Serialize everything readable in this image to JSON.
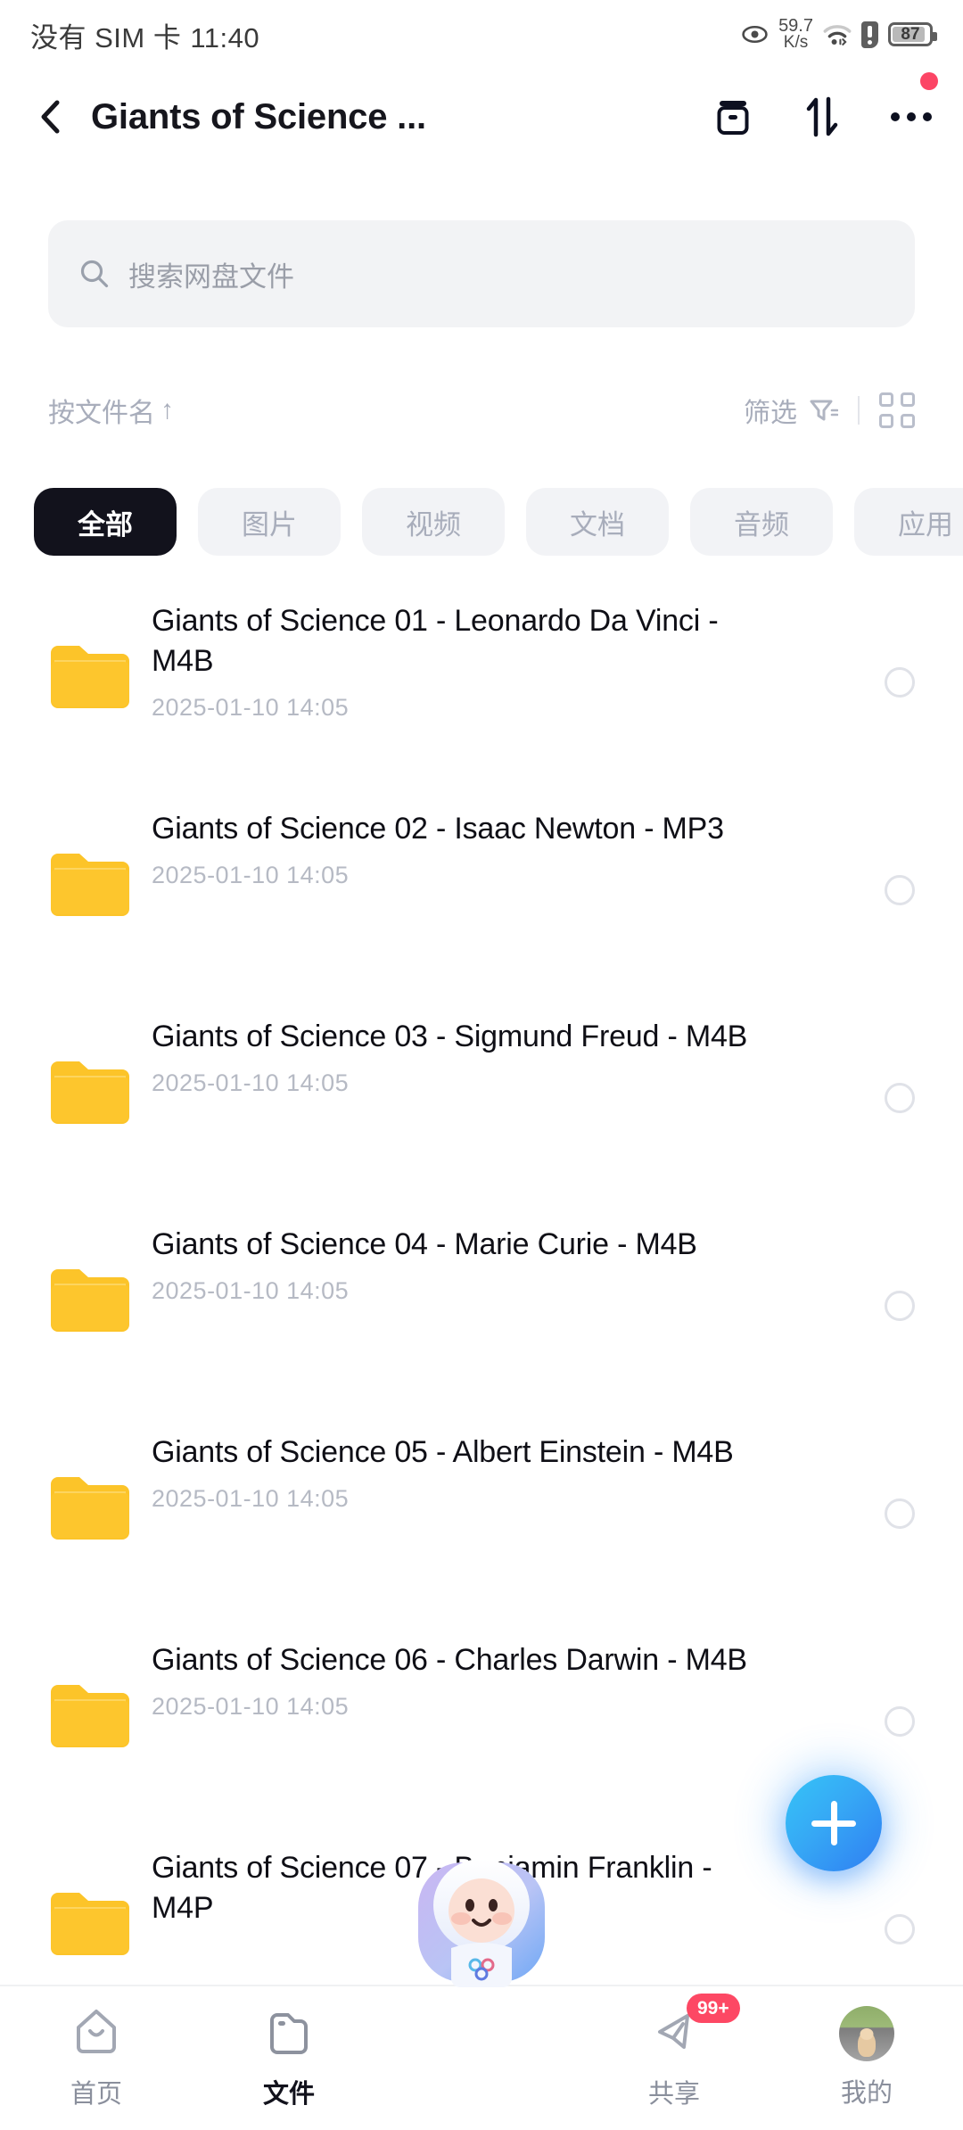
{
  "statusbar": {
    "carrier": "没有 SIM 卡",
    "time": "11:40",
    "net_speed": "59.7",
    "net_unit": "K/s",
    "battery": "87",
    "icons": [
      "eye-icon",
      "wifi-icon",
      "sim-warning-icon",
      "battery-icon"
    ]
  },
  "header": {
    "title": "Giants of Science ...",
    "back_icon": "chevron-left-icon",
    "archive_icon": "archive-box-icon",
    "transfer_icon": "transfer-up-down-icon",
    "more_icon": "more-dots-icon",
    "more_badge": true
  },
  "search": {
    "placeholder": "搜索网盘文件",
    "icon": "search-icon"
  },
  "sort_row": {
    "sort_label": "按文件名",
    "sort_arrow": "↑",
    "filter_label": "筛选",
    "filter_icon": "funnel-icon",
    "view_icon": "grid-view-icon"
  },
  "chips": [
    {
      "label": "全部",
      "active": true
    },
    {
      "label": "图片",
      "active": false
    },
    {
      "label": "视频",
      "active": false
    },
    {
      "label": "文档",
      "active": false
    },
    {
      "label": "音频",
      "active": false
    },
    {
      "label": "应用",
      "active": false
    },
    {
      "label": "",
      "active": false
    }
  ],
  "files": [
    {
      "name": "Giants of Science 01 - Leonardo Da Vinci - M4B",
      "date": "2025-01-10",
      "time": "14:05",
      "icon": "folder-icon"
    },
    {
      "name": "Giants of Science 02 - Isaac Newton - MP3",
      "date": "2025-01-10",
      "time": "14:05",
      "icon": "folder-icon"
    },
    {
      "name": "Giants of Science 03 - Sigmund Freud - M4B",
      "date": "2025-01-10",
      "time": "14:05",
      "icon": "folder-icon"
    },
    {
      "name": "Giants of Science 04 - Marie Curie - M4B",
      "date": "2025-01-10",
      "time": "14:05",
      "icon": "folder-icon"
    },
    {
      "name": "Giants of Science 05 - Albert Einstein - M4B",
      "date": "2025-01-10",
      "time": "14:05",
      "icon": "folder-icon"
    },
    {
      "name": "Giants of Science 06 - Charles Darwin - M4B",
      "date": "2025-01-10",
      "time": "14:05",
      "icon": "folder-icon"
    },
    {
      "name": "Giants of Science 07 - Benjamin Franklin - M4P",
      "date": "",
      "time": "",
      "icon": "folder-icon"
    }
  ],
  "fab": {
    "icon": "plus-icon"
  },
  "navbar": [
    {
      "label": "首页",
      "icon": "home-icon",
      "active": false,
      "badge": ""
    },
    {
      "label": "文件",
      "icon": "folder-nav-icon",
      "active": true,
      "badge": ""
    },
    {
      "label": "",
      "icon": "mascot-assistant-icon",
      "active": false,
      "badge": ""
    },
    {
      "label": "共享",
      "icon": "share-paperplane-icon",
      "active": false,
      "badge": "99+"
    },
    {
      "label": "我的",
      "icon": "user-avatar-icon",
      "active": false,
      "badge": ""
    }
  ],
  "colors": {
    "accent_blue": "#36a8f5",
    "badge_red": "#fd4864",
    "chip_active_bg": "#12121c",
    "folder_yellow": "#fdc72f",
    "muted_text": "#a8adbb"
  }
}
